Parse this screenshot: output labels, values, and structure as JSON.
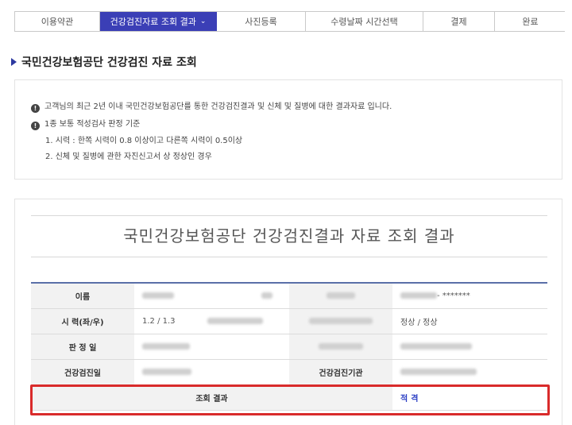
{
  "steps": [
    {
      "label": "이용약관",
      "active": false
    },
    {
      "label": "건강검진자료 조회 결과",
      "active": true
    },
    {
      "label": "사진등록",
      "active": false
    },
    {
      "label": "수령날짜 시간선택",
      "active": false
    },
    {
      "label": "결제",
      "active": false
    },
    {
      "label": "완료",
      "active": false
    }
  ],
  "section_title": "국민건강보험공단 건강검진 자료 조회",
  "info": {
    "line1": "고객님의 최근 2년 이내 국민건강보험공단를 통한 건강검진결과 및 신체 및 질병에 대한 결과자료 입니다.",
    "line2": "1종 보통 적성검사 판정 기준",
    "line3": "1. 시력 : 한쪽 시력이 0.8 이상이고 다른쪽 시력이 0.5이상",
    "line4": "2. 신체 및 질병에 관한 자진신고서 상 정상인 경우"
  },
  "result": {
    "title": "국민건강보험공단 건강검진결과 자료 조회 결과",
    "rows": [
      {
        "label": "이름",
        "value": "",
        "label2": "",
        "value2": "- *******"
      },
      {
        "label": "시 력(좌/우)",
        "value": "1.2 / 1.3",
        "label2": "",
        "value2": "정상 / 정상"
      },
      {
        "label": "판 정 일",
        "value": "",
        "label2": "",
        "value2": ""
      },
      {
        "label": "건강검진일",
        "value": "",
        "label2": "건강검진기관",
        "value2": ""
      }
    ],
    "query_result_label": "조회 결과",
    "query_result_value": "적격"
  },
  "colors": {
    "accent": "#3b3fb6",
    "highlight": "#d92b2b",
    "result_value": "#2b3ec4"
  }
}
